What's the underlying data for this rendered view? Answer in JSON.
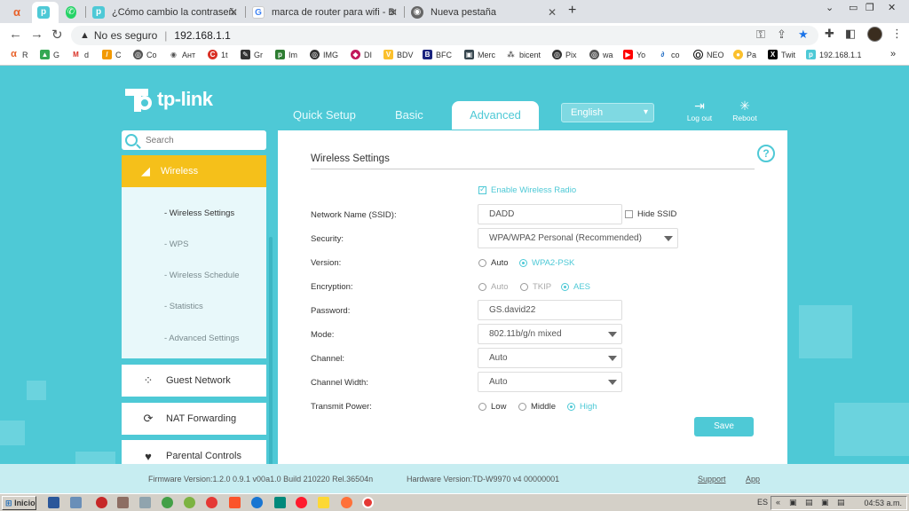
{
  "browser": {
    "tabs": [
      {
        "title": "",
        "active": false
      },
      {
        "title": "",
        "active": true
      },
      {
        "title": "",
        "active": false
      },
      {
        "title": "¿Cómo cambio la contraseña admini",
        "active": false
      },
      {
        "title": "marca de router para wifi - Buscar c",
        "active": false
      },
      {
        "title": "Nueva pestaña",
        "active": false
      }
    ],
    "new_tab": "+",
    "address": {
      "security": "No es seguro",
      "url": "192.168.1.1"
    },
    "bookmarks": [
      "R",
      "G",
      "d",
      "C",
      "Co",
      "Ант",
      "1t",
      "Gr",
      "Im",
      "IMG",
      "DI",
      "BDV",
      "BFC",
      "Merc",
      "bicent",
      "Pix",
      "wa",
      "Yo",
      "co",
      "NEO",
      "Pa",
      "Twit",
      "192.168.1.1"
    ],
    "bookmarks_more": "»"
  },
  "router": {
    "brand": "tp-link",
    "nav": {
      "quick_setup": "Quick Setup",
      "basic": "Basic",
      "advanced": "Advanced"
    },
    "language": "English",
    "logout": "Log out",
    "reboot": "Reboot",
    "search_placeholder": "Search",
    "sidebar": {
      "wireless": "Wireless",
      "sub": [
        "- Wireless Settings",
        "- WPS",
        "- Wireless Schedule",
        "- Statistics",
        "- Advanced Settings"
      ],
      "guest": "Guest Network",
      "nat": "NAT Forwarding",
      "parental": "Parental Controls"
    },
    "panel": {
      "title": "Wireless Settings",
      "help": "?",
      "enable_radio": "Enable Wireless Radio",
      "ssid_label": "Network Name (SSID):",
      "ssid_value": "DADD",
      "hide_ssid": "Hide SSID",
      "security_label": "Security:",
      "security_value": "WPA/WPA2 Personal (Recommended)",
      "version_label": "Version:",
      "version_opts": [
        "Auto",
        "WPA2-PSK"
      ],
      "encryption_label": "Encryption:",
      "encryption_opts": [
        "Auto",
        "TKIP",
        "AES"
      ],
      "password_label": "Password:",
      "password_value": "GS.david22",
      "mode_label": "Mode:",
      "mode_value": "802.11b/g/n mixed",
      "channel_label": "Channel:",
      "channel_value": "Auto",
      "width_label": "Channel Width:",
      "width_value": "Auto",
      "power_label": "Transmit Power:",
      "power_opts": [
        "Low",
        "Middle",
        "High"
      ],
      "save": "Save"
    },
    "footer": {
      "firmware": "Firmware Version:1.2.0 0.9.1 v00a1.0 Build 210220 Rel.36504n",
      "hardware": "Hardware Version:TD-W9970 v4 00000001",
      "support": "Support",
      "app": "App"
    }
  },
  "taskbar": {
    "start": "Inicio",
    "lang": "ES",
    "clock": "04:53 a.m."
  },
  "colors": {
    "teal": "#4ec9d6",
    "yellow": "#f5c01a"
  }
}
